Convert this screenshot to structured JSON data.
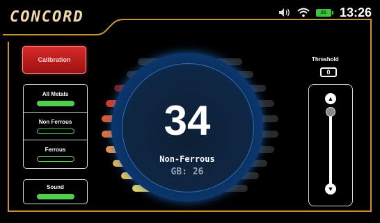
{
  "header": {
    "logo": "CONCORD",
    "battery_level": "91",
    "time": "13:26"
  },
  "calibration": {
    "label": "Calibration"
  },
  "modes": [
    {
      "label": "All Metals",
      "active": true
    },
    {
      "label": "Non Ferrous",
      "active": false
    },
    {
      "label": "Ferrous",
      "active": false
    }
  ],
  "sound": {
    "label": "Sound",
    "active": true
  },
  "gauge": {
    "value": "34",
    "mode_text": "Non-Ferrous",
    "gb_text": "GB: 26"
  },
  "threshold": {
    "label": "Threshold",
    "value": "0",
    "up_icon": "chevron-up-icon",
    "down_icon": "chevron-down-icon"
  },
  "colors": {
    "accent_gold": "#c8962e",
    "calibration_red": "#c41a1a",
    "active_green": "#4dcf4d",
    "gauge_blue": "#1b6bc8"
  }
}
